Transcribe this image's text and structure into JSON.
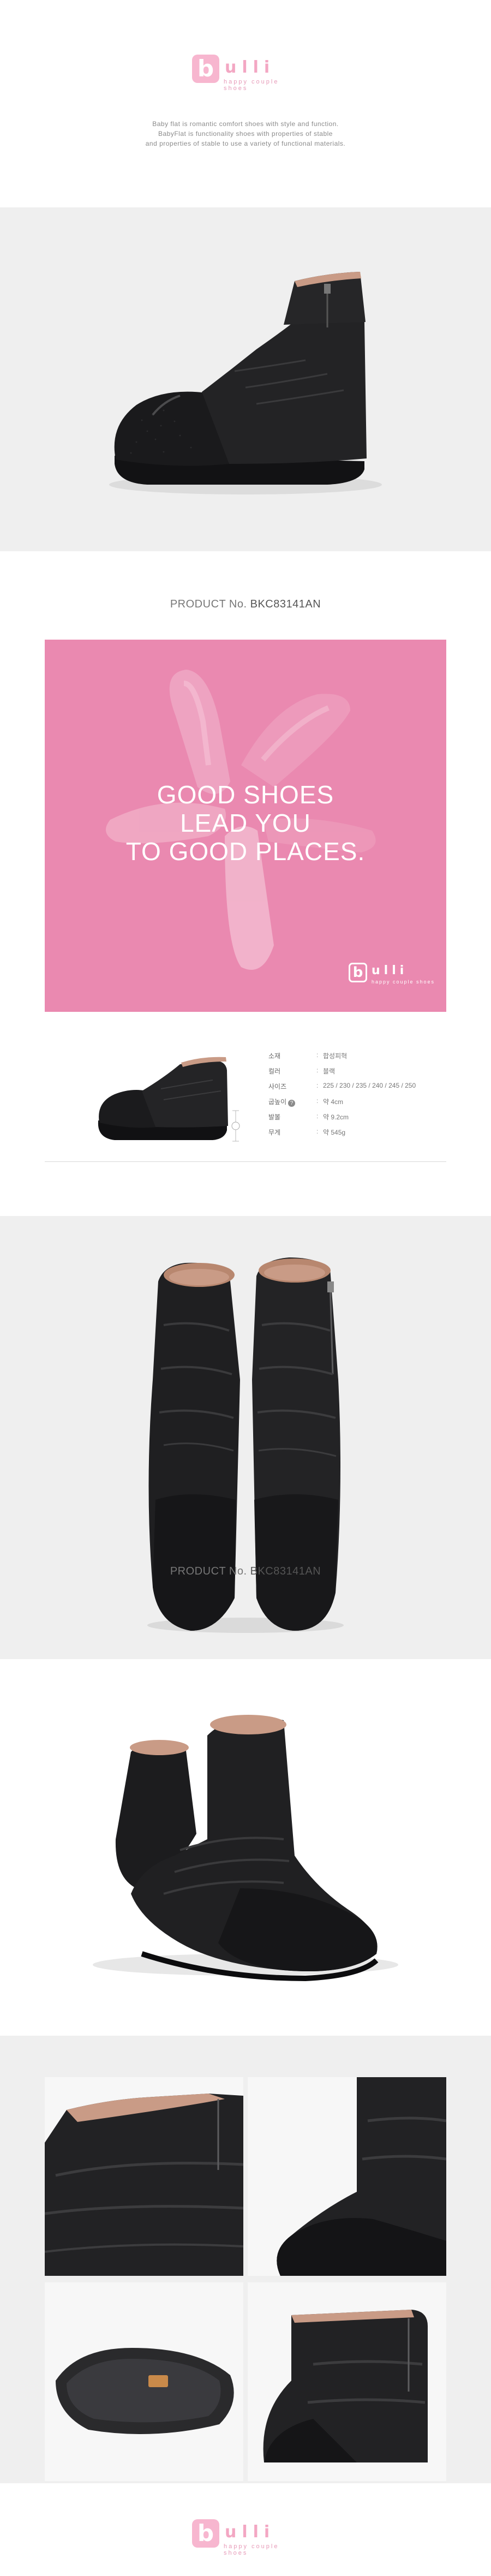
{
  "brand": {
    "logo_letter": "b",
    "logo_word": "ulli",
    "tagline": "happy couple shoes"
  },
  "intro_lines": [
    "Baby flat is romantic comfort shoes with style and function.",
    "BabyFlat is functionality shoes with properties of stable",
    "and properties of stable to use a variety of functional materials."
  ],
  "product": {
    "no_label": "PRODUCT No.",
    "code": "BKC83141AN"
  },
  "slogan": {
    "lines": [
      "GOOD SHOES",
      "LEAD YOU",
      "TO GOOD PLACES."
    ]
  },
  "specs": [
    {
      "label": "소재",
      "value": "합성피혁",
      "help": false
    },
    {
      "label": "컬러",
      "value": "블랙",
      "help": false
    },
    {
      "label": "사이즈",
      "value": "225 / 230 / 235 / 240 / 245 / 250",
      "help": false
    },
    {
      "label": "굽높이",
      "value": "약 4cm",
      "help": true,
      "help_glyph": "?"
    },
    {
      "label": "발볼",
      "value": "약 9.2cm",
      "help": false
    },
    {
      "label": "무게",
      "value": "약 545g",
      "help": false
    }
  ],
  "colors": {
    "pink_panel": "#ea89b0",
    "logo_pink": "#f7b6cf",
    "band_grey": "#efefef",
    "shoe_black": "#1e1e20",
    "lining_tan": "#c99b86"
  },
  "icons": {
    "help": "question-circle-icon",
    "height_marker": "circle-marker-icon"
  }
}
